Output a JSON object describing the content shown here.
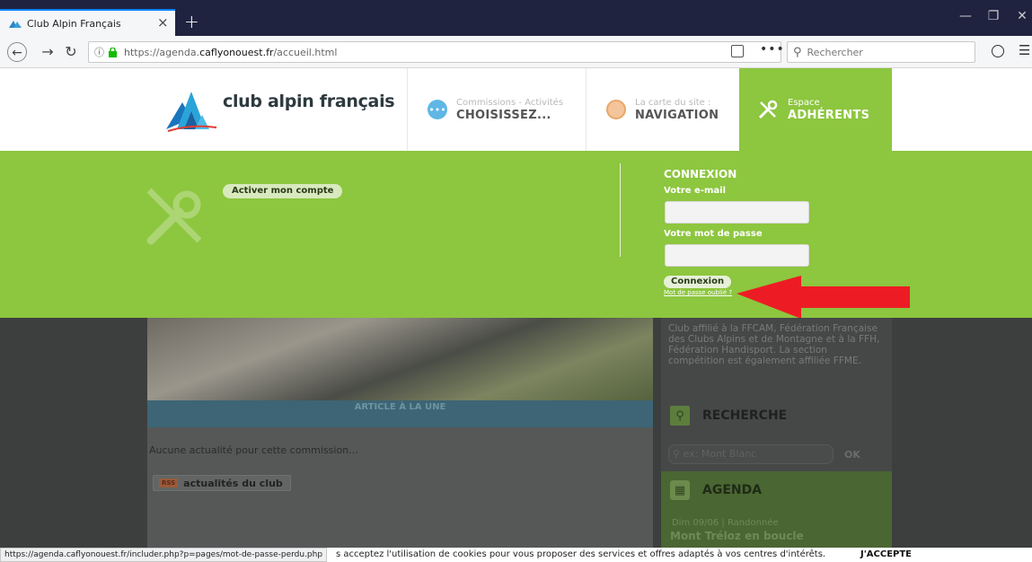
{
  "browser": {
    "tab_title": "Club Alpin Français",
    "tab_close": "×",
    "new_tab": "+",
    "url_host_prefix": "https://agenda.",
    "url_host_bold": "caflyonouest.fr",
    "url_path": "/accueil.html",
    "search_placeholder": "Rechercher",
    "dots": "•••",
    "menu": "☰",
    "win_min": "—",
    "win_max": "❐",
    "win_close": "✕"
  },
  "header": {
    "brand_name": "club alpin français",
    "nav": [
      {
        "line1": "Commissions - Activités",
        "line2": "CHOISISSEZ..."
      },
      {
        "line1": "La carte du site :",
        "line2": "NAVIGATION"
      },
      {
        "line1": "Espace",
        "line2": "ADHÉRENTS"
      }
    ]
  },
  "panel": {
    "activate_label": "Activer mon compte",
    "login_title": "CONNEXION",
    "email_label": "Votre e-mail",
    "password_label": "Votre mot de passe",
    "login_button": "Connexion",
    "forgot_link": "Mot de passe oublié ?"
  },
  "main": {
    "article_band": "ARTICLE À LA UNE",
    "no_news": "Aucune actualité pour cette commission...",
    "news_badge": "RSS",
    "news_tag": "actualités du club"
  },
  "sidebar": {
    "affiliation": "Club affilié à la FFCAM, Fédération Française des Clubs Alpins et de Montagne et à la FFH, Fédération Handisport. La section compétition est également affiliée FFME.",
    "search_title": "RECHERCHE",
    "search_placeholder": "ex: Mont Blanc",
    "search_ok": "OK",
    "agenda_title": "AGENDA",
    "agenda_date": "Dim 09/06",
    "agenda_category": "Randonnée",
    "agenda_event": "Mont Tréloz en boucle"
  },
  "status": {
    "hover_url": "https://agenda.caflyonouest.fr/includer.php?p=pages/mot-de-passe-perdu.php",
    "cookie_text": "s acceptez l'utilisation de cookies pour vous proposer des services et offres adaptés à vos centres d'intérêts.",
    "cookie_accept": "J'ACCEPTE"
  },
  "colors": {
    "green": "#8dc63f",
    "arrow_red": "#ed1c24",
    "titlebar": "#1f2340"
  }
}
